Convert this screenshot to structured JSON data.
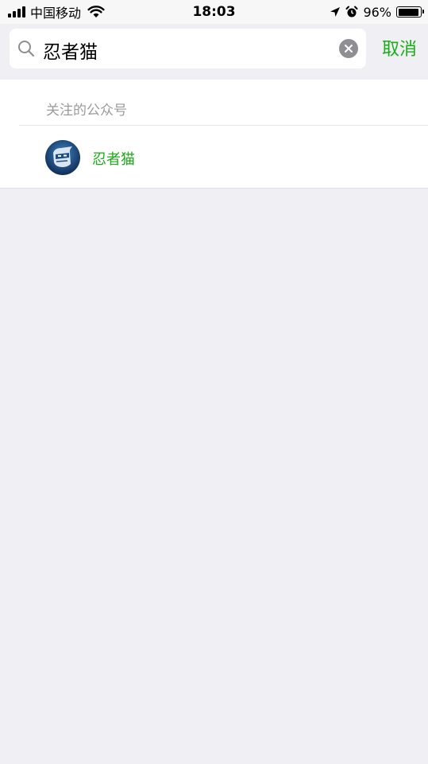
{
  "status_bar": {
    "carrier": "中国移动",
    "time": "18:03",
    "battery_percent": "96%",
    "battery_level": 0.96,
    "icons": [
      "signal-icon",
      "wifi-icon",
      "location-icon",
      "alarm-icon",
      "battery-icon"
    ]
  },
  "search": {
    "query": "忍者猫",
    "cancel_label": "取消"
  },
  "results": {
    "section_title": "关注的公众号",
    "items": [
      {
        "name": "忍者猫"
      }
    ]
  },
  "colors": {
    "accent": "#1aad19",
    "background": "#efeff4",
    "secondary_text": "#9b9b9b"
  }
}
